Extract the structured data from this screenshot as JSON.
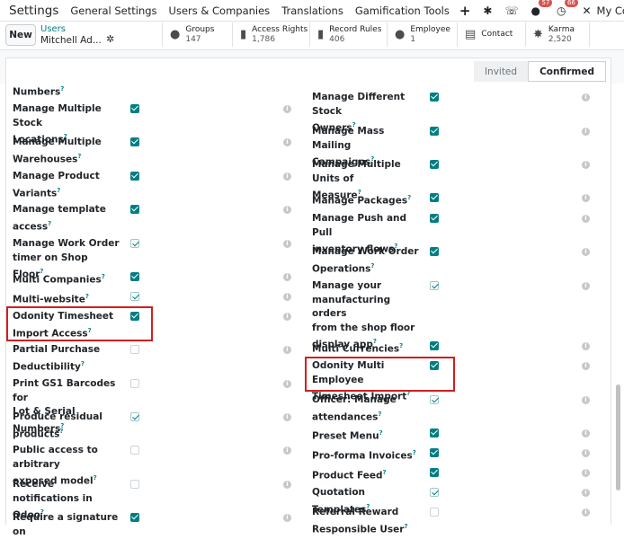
{
  "navbar": {
    "app": "Settings",
    "menus": [
      "General Settings",
      "Users & Companies",
      "Translations",
      "Gamification Tools"
    ],
    "messages_count": "57",
    "activities_count": "66",
    "company": "My Company (San"
  },
  "controlbar": {
    "new_label": "New",
    "breadcrumb_parent": "Users",
    "breadcrumb_current": "Mitchell Ad...",
    "smart_buttons": [
      {
        "label": "Groups",
        "value": "147",
        "icon": "users-icon"
      },
      {
        "label": "Access Rights",
        "value": "1,786",
        "icon": "lock-icon"
      },
      {
        "label": "Record Rules",
        "value": "406",
        "icon": "lock-icon"
      },
      {
        "label": "Employee",
        "value": "1",
        "icon": "user-icon"
      },
      {
        "label": "Contact",
        "value": "",
        "icon": "id-card-icon"
      },
      {
        "label": "Karma",
        "value": "2,520",
        "icon": "star-icon"
      }
    ]
  },
  "status": {
    "stages": [
      "Invited",
      "Confirmed"
    ],
    "active": "Confirmed"
  },
  "left_column": [
    {
      "lines": [
        "Numbers"
      ],
      "help": true,
      "state": "",
      "info": false
    },
    {
      "lines": [
        "Manage Multiple Stock",
        "Locations"
      ],
      "help": true,
      "state": "on",
      "info": true
    },
    {
      "lines": [
        "Manage Multiple",
        "Warehouses"
      ],
      "help": true,
      "state": "on",
      "info": true
    },
    {
      "lines": [
        "Manage Product",
        "Variants"
      ],
      "help": true,
      "state": "on",
      "info": true
    },
    {
      "lines": [
        "Manage template",
        "access"
      ],
      "help": true,
      "state": "on",
      "info": true
    },
    {
      "lines": [
        "Manage Work Order",
        "timer on Shop Floor"
      ],
      "help": true,
      "state": "ro",
      "info": true
    },
    {
      "lines": [
        "Multi Companies"
      ],
      "help": true,
      "state": "on",
      "info": true
    },
    {
      "lines": [
        "Multi-website"
      ],
      "help": true,
      "state": "ro",
      "info": true
    },
    {
      "lines": [
        "Odonity Timesheet",
        "Import Access"
      ],
      "help": true,
      "state": "on",
      "info": true
    },
    {
      "lines": [
        "Partial Purchase",
        "Deductibility"
      ],
      "help": true,
      "state": "off",
      "info": true
    },
    {
      "lines": [
        "Print GS1 Barcodes for",
        "Lot & Serial Numbers"
      ],
      "help": true,
      "state": "off",
      "info": true
    },
    {
      "lines": [
        "Produce residual",
        "products"
      ],
      "help": true,
      "state": "ro",
      "info": true
    },
    {
      "lines": [
        "Public access to arbitrary",
        "exposed model"
      ],
      "help": true,
      "state": "off",
      "info": true
    },
    {
      "lines": [
        "Receive notifications in",
        "Odoo"
      ],
      "help": true,
      "state": "off",
      "info": true
    },
    {
      "lines": [
        "Require a signature on"
      ],
      "help": false,
      "state": "on",
      "info": true
    }
  ],
  "right_column": [
    {
      "lines": [
        "Manage Different Stock",
        "Owners"
      ],
      "help": true,
      "state": "on",
      "info": true
    },
    {
      "lines": [
        "Manage Mass Mailing",
        "Campaigns"
      ],
      "help": true,
      "state": "on",
      "info": true
    },
    {
      "lines": [
        "Manage Multiple Units of",
        "Measure"
      ],
      "help": true,
      "state": "on",
      "info": true
    },
    {
      "lines": [
        "Manage Packages"
      ],
      "help": true,
      "state": "on",
      "info": true
    },
    {
      "lines": [
        "Manage Push and Pull",
        "inventory flows"
      ],
      "help": true,
      "state": "on",
      "info": true
    },
    {
      "lines": [
        "Manage Work Order",
        "Operations"
      ],
      "help": true,
      "state": "on",
      "info": true
    },
    {
      "lines": [
        "Manage your",
        "manufacturing orders",
        "from the shop floor",
        "display app"
      ],
      "help": true,
      "state": "ro",
      "info": true
    },
    {
      "lines": [
        "Multi Currencies"
      ],
      "help": true,
      "state": "on",
      "info": true
    },
    {
      "lines": [
        "Odonity Multi Employee",
        "Timesheet Import"
      ],
      "help": true,
      "state": "on",
      "info": true
    },
    {
      "lines": [
        "Officer: Manage",
        "attendances"
      ],
      "help": true,
      "state": "ro",
      "info": true
    },
    {
      "lines": [
        "Preset Menu"
      ],
      "help": true,
      "state": "on",
      "info": true
    },
    {
      "lines": [
        "Pro-forma Invoices"
      ],
      "help": true,
      "state": "on",
      "info": true
    },
    {
      "lines": [
        "Product Feed"
      ],
      "help": true,
      "state": "on",
      "info": true
    },
    {
      "lines": [
        "Quotation Templates"
      ],
      "help": true,
      "state": "ro",
      "info": true
    },
    {
      "lines": [
        "Referral Reward",
        "Responsible User"
      ],
      "help": true,
      "state": "off",
      "info": true
    }
  ]
}
